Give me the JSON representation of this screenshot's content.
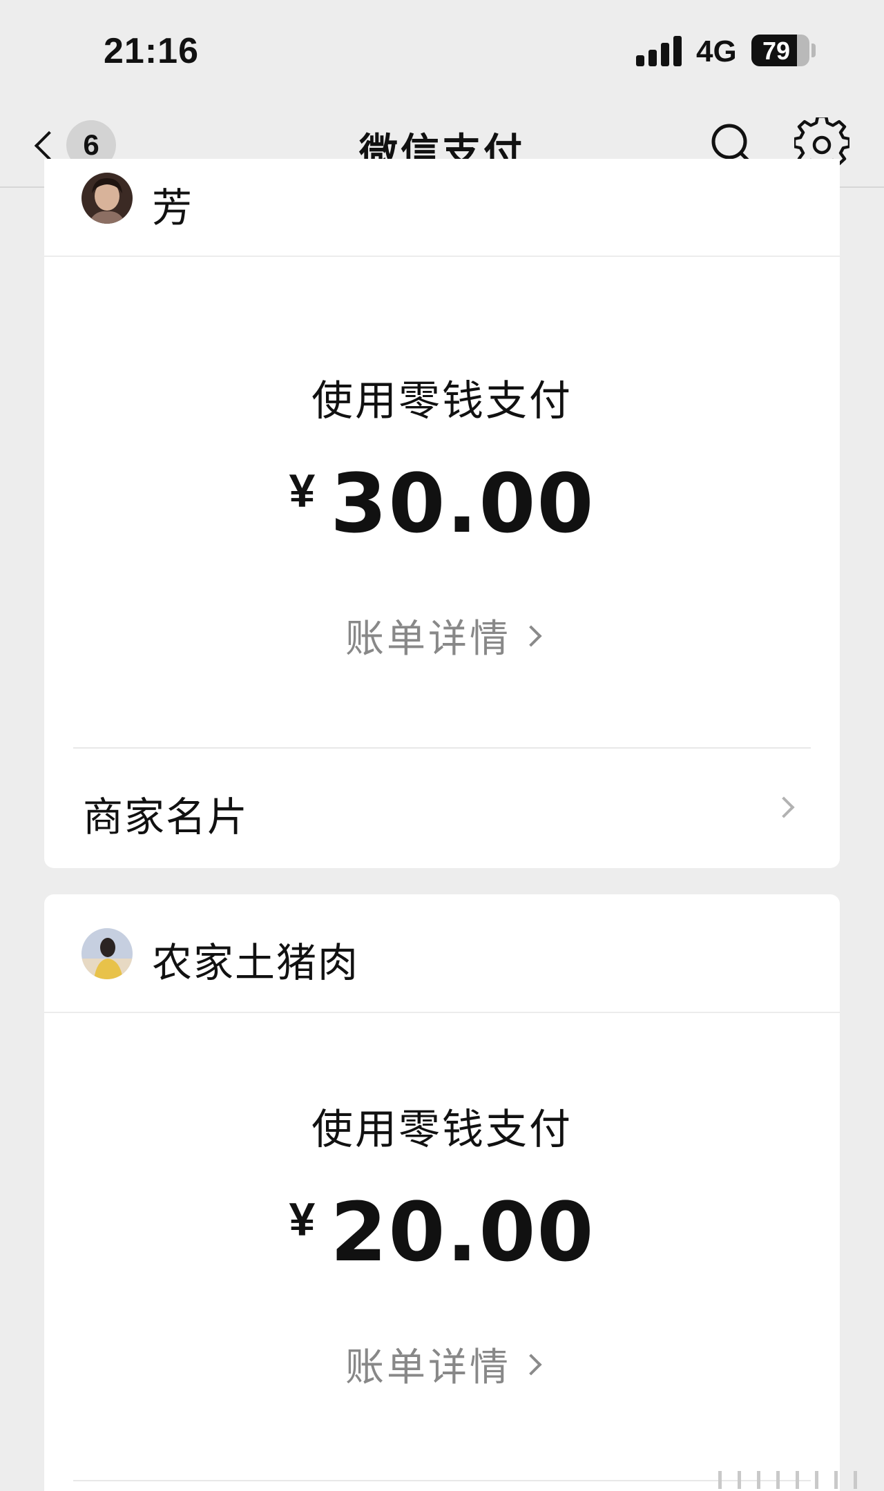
{
  "status_bar": {
    "time": "21:16",
    "network": "4G",
    "battery_level": "79",
    "battery_fraction": 0.79
  },
  "nav": {
    "unread_count": "6",
    "title": "微信支付",
    "search_icon": "search-icon",
    "settings_icon": "gear-icon"
  },
  "payments": [
    {
      "merchant": "芳",
      "method": "使用零钱支付",
      "currency": "¥",
      "amount": "30.00",
      "bill_link": "账单详情",
      "merchant_card": "商家名片"
    },
    {
      "merchant": "农家土猪肉",
      "method": "使用零钱支付",
      "currency": "¥",
      "amount": "20.00",
      "bill_link": "账单详情"
    }
  ],
  "colors": {
    "background": "#ededed",
    "card": "#ffffff",
    "secondary_text": "#888888"
  }
}
